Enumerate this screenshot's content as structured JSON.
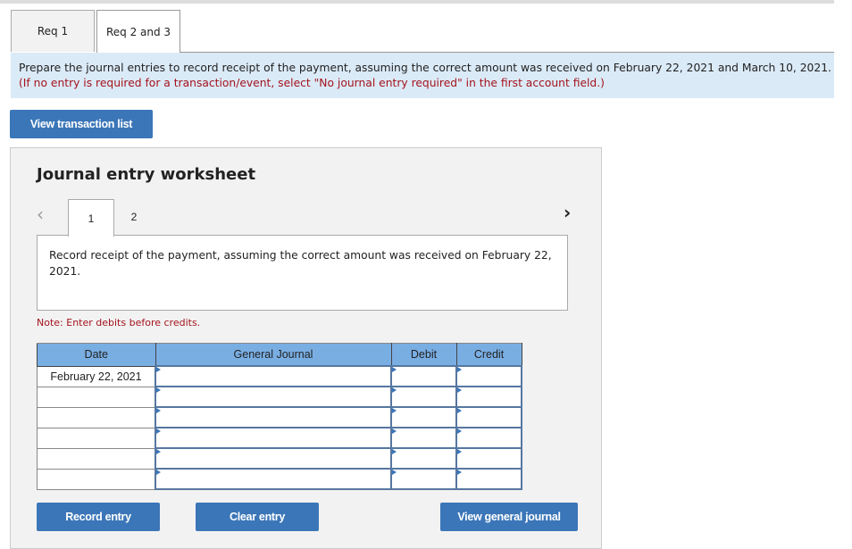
{
  "tabs": [
    {
      "label": "Req 1",
      "active": false
    },
    {
      "label": "Req 2 and 3",
      "active": true
    }
  ],
  "instructions": {
    "text": "Prepare the journal entries to record receipt of the payment, assuming the correct amount was received on February 22, 2021 and March 10, 2021.",
    "note": "(If no entry is required for a transaction/event, select \"No journal entry required\" in the first account field.)"
  },
  "view_transaction_list_label": "View transaction list",
  "worksheet": {
    "title": "Journal entry worksheet",
    "entry_tabs": [
      {
        "label": "1",
        "active": true
      },
      {
        "label": "2",
        "active": false
      }
    ],
    "description": "Record receipt of the payment, assuming the correct amount was received on February 22, 2021.",
    "note": "Note: Enter debits before credits.",
    "table": {
      "headers": {
        "date": "Date",
        "general_journal": "General Journal",
        "debit": "Debit",
        "credit": "Credit"
      },
      "rows": [
        {
          "date": "February 22, 2021",
          "account": "",
          "debit": "",
          "credit": ""
        },
        {
          "date": "",
          "account": "",
          "debit": "",
          "credit": ""
        },
        {
          "date": "",
          "account": "",
          "debit": "",
          "credit": ""
        },
        {
          "date": "",
          "account": "",
          "debit": "",
          "credit": ""
        },
        {
          "date": "",
          "account": "",
          "debit": "",
          "credit": ""
        },
        {
          "date": "",
          "account": "",
          "debit": "",
          "credit": ""
        }
      ]
    },
    "buttons": {
      "record": "Record entry",
      "clear": "Clear entry",
      "view_general_journal": "View general journal"
    }
  },
  "colors": {
    "button_blue": "#3b76b8",
    "header_blue": "#79aee3",
    "instruction_bg": "#dbeaf7",
    "note_red": "#a3131d"
  }
}
